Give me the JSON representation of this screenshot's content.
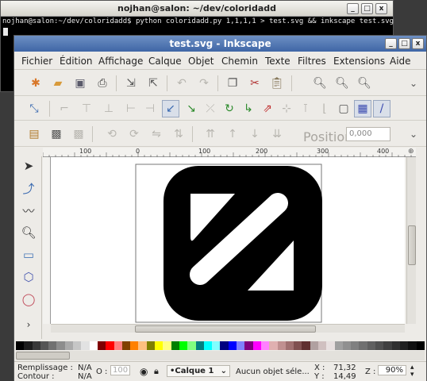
{
  "terminal": {
    "title": "nojhan@salon: ~/dev/coloridadd",
    "command_line": "nojhan@salon:~/dev/coloridadd$ python coloridadd.py 1,1,1,1 > test.svg && inkscape test.svg",
    "buttons": {
      "minimize": "_",
      "maximize": "□",
      "close": "x"
    }
  },
  "inkscape": {
    "title": "test.svg - Inkscape",
    "buttons": {
      "minimize": "_",
      "maximize": "□",
      "close": "x"
    },
    "menu": [
      "Fichier",
      "Édition",
      "Affichage",
      "Calque",
      "Objet",
      "Chemin",
      "Texte",
      "Filtres",
      "Extensions",
      "Aide"
    ],
    "controls": {
      "position_label": "Position X",
      "position_value": "0,000"
    },
    "ruler": {
      "ticks": [
        "100",
        "0",
        "100",
        "200",
        "300",
        "400"
      ]
    },
    "palette_colors": [
      "#000000",
      "#1c1c1c",
      "#383838",
      "#555555",
      "#717171",
      "#8d8d8d",
      "#aaaaaa",
      "#c6c6c6",
      "#e2e2e2",
      "#ffffff",
      "#800000",
      "#ff0000",
      "#ff8080",
      "#804000",
      "#ff8000",
      "#ffc080",
      "#808000",
      "#ffff00",
      "#ffff80",
      "#008000",
      "#00ff00",
      "#80ff80",
      "#008080",
      "#00ffff",
      "#80ffff",
      "#000080",
      "#0000ff",
      "#8080ff",
      "#800080",
      "#ff00ff",
      "#ff80ff",
      "#e0b0b0",
      "#c09090",
      "#a07070",
      "#805050",
      "#603030",
      "#b0a0a0",
      "#d0c0c0",
      "#e8e0e0",
      "#a0a0a0",
      "#909090",
      "#808080",
      "#707070",
      "#606060",
      "#505050",
      "#404040",
      "#303030",
      "#202020",
      "#101010",
      "#000000"
    ],
    "status": {
      "fill_label": "Remplissage :",
      "fill_value": "N/A",
      "stroke_label": "Contour :",
      "stroke_value": "N/A",
      "opacity_label": "O :",
      "opacity_value": "100",
      "layer": "•Calque 1",
      "message": "Aucun objet séle...",
      "x_label": "X :",
      "x_value": "71,32",
      "y_label": "Y :",
      "y_value": "14,49",
      "zoom_label": "Z :",
      "zoom_value": "90%"
    }
  }
}
